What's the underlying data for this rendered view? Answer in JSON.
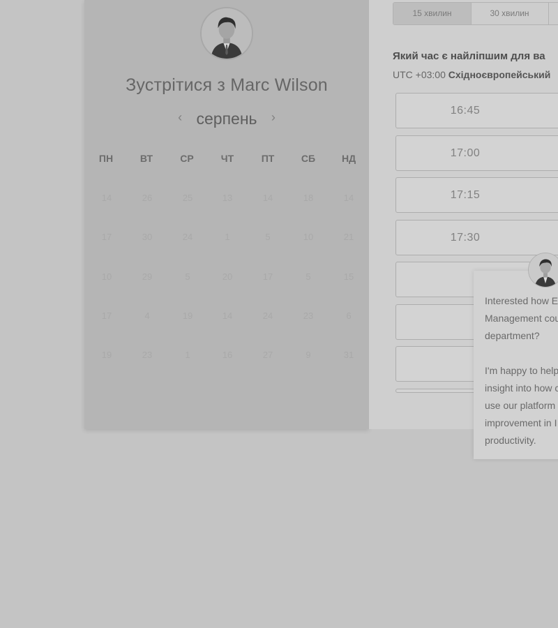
{
  "host": {
    "title": "Зустрітися з Marc Wilson",
    "avatar_icon": "person-avatar-icon"
  },
  "calendar": {
    "month": "серпень",
    "prev_icon": "chevron-left-icon",
    "next_icon": "chevron-right-icon",
    "prev_glyph": "‹",
    "next_glyph": "›",
    "weekdays": [
      "ПН",
      "ВТ",
      "СР",
      "ЧТ",
      "ПТ",
      "СБ",
      "НД"
    ],
    "weeks": [
      [
        "14",
        "26",
        "25",
        "13",
        "14",
        "18",
        "14"
      ],
      [
        "17",
        "30",
        "24",
        "1",
        "5",
        "10",
        "21"
      ],
      [
        "10",
        "29",
        "5",
        "20",
        "17",
        "5",
        "15"
      ],
      [
        "17",
        "4",
        "19",
        "14",
        "24",
        "23",
        "6"
      ],
      [
        "19",
        "23",
        "1",
        "16",
        "27",
        "9",
        "31"
      ]
    ]
  },
  "durations": {
    "options": [
      "15 хвилин",
      "30 хвилин"
    ],
    "selected": "15 хвилин"
  },
  "scheduler": {
    "question": "Який час є найліпшим для ва",
    "timezone_offset": "UTC +03:00",
    "timezone_name": "Східноєвропейський"
  },
  "time_slots": [
    "16:45",
    "17:00",
    "17:15",
    "17:30",
    "",
    "",
    "",
    ""
  ],
  "chat": {
    "avatar_icon": "person-avatar-icon",
    "message": "Interested how E\nManagement cou\ndepartment?\n\nI'm happy to help\ninsight into how c\nuse our platform\nimprovement in I\nproductivity."
  },
  "colors": {
    "overlay_background": "#c4c4c4",
    "calendar_panel": "#b5b5b5",
    "slots_panel": "#cfcfcf"
  }
}
